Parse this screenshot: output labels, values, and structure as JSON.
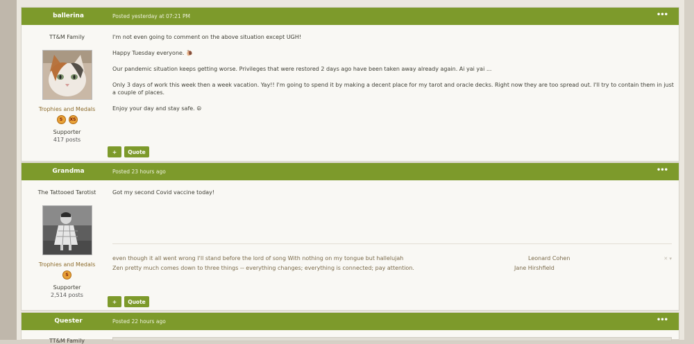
{
  "posts": [
    {
      "author": "ballerina",
      "posted": "Posted yesterday at 07:21 PM",
      "title": "TT&M Family",
      "trophies_label": "Trophies and Medals",
      "medals": [
        "S",
        "XS"
      ],
      "rank": "Supporter",
      "post_count": "417 posts",
      "body": [
        "I'm not even going to comment on the above situation except UGH!",
        "Happy Tuesday everyone. 🐌",
        "Our pandemic situation keeps getting worse.  Privileges that were restored 2 days ago have been taken away already again.  Ai yai yai ...",
        "Only 3 days of work this week then a week vacation.  Yay!!  I'm going to spend it by making a decent place for my tarot and oracle decks.  Right now they are too spread out.  I'll try to contain them in just a couple of places.",
        "Enjoy your day and stay safe. ☮"
      ],
      "plus_label": "+",
      "quote_label": "Quote"
    },
    {
      "author": "Grandma",
      "posted": "Posted 23 hours ago",
      "title": "The Tattooed Tarotist",
      "trophies_label": "Trophies and Medals",
      "medals": [
        "S"
      ],
      "rank": "Supporter",
      "post_count": "2,514 posts",
      "body": [
        "Got my second Covid vaccine today!"
      ],
      "signature": [
        {
          "quote": "even though it all went wrong I'll stand before the lord of song With nothing on my tongue but hallelujah",
          "author": "Leonard Cohen"
        },
        {
          "quote": "Zen pretty much comes down to three things -- everything changes; everything is connected; pay attention.",
          "author": "Jane Hirshfield"
        }
      ],
      "sig_close": "✕ ▾",
      "plus_label": "+",
      "quote_label": "Quote"
    },
    {
      "author": "Quester",
      "posted": "Posted 22 hours ago",
      "title": "TT&M Family"
    }
  ],
  "menu_icon": "•••",
  "colors": {
    "accent": "#7d9a2b",
    "background": "#f9f8f4"
  }
}
